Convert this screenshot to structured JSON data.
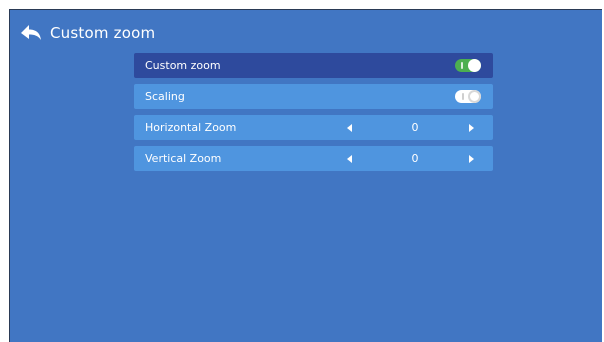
{
  "header": {
    "title": "Custom zoom"
  },
  "menu": {
    "items": [
      {
        "label": "Custom zoom",
        "control": "toggle",
        "state": "on"
      },
      {
        "label": "Scaling",
        "control": "toggle",
        "state": "off"
      },
      {
        "label": "Horizontal Zoom",
        "control": "stepper",
        "value": "0"
      },
      {
        "label": "Vertical Zoom",
        "control": "stepper",
        "value": "0"
      }
    ]
  },
  "colors": {
    "background": "#4176c3",
    "row": "#4f95df",
    "row_focused": "#2e4a9d",
    "toggle_on": "#4caf50"
  },
  "icons": {
    "back": "back-arrow-icon",
    "left": "triangle-left-icon",
    "right": "triangle-right-icon"
  }
}
